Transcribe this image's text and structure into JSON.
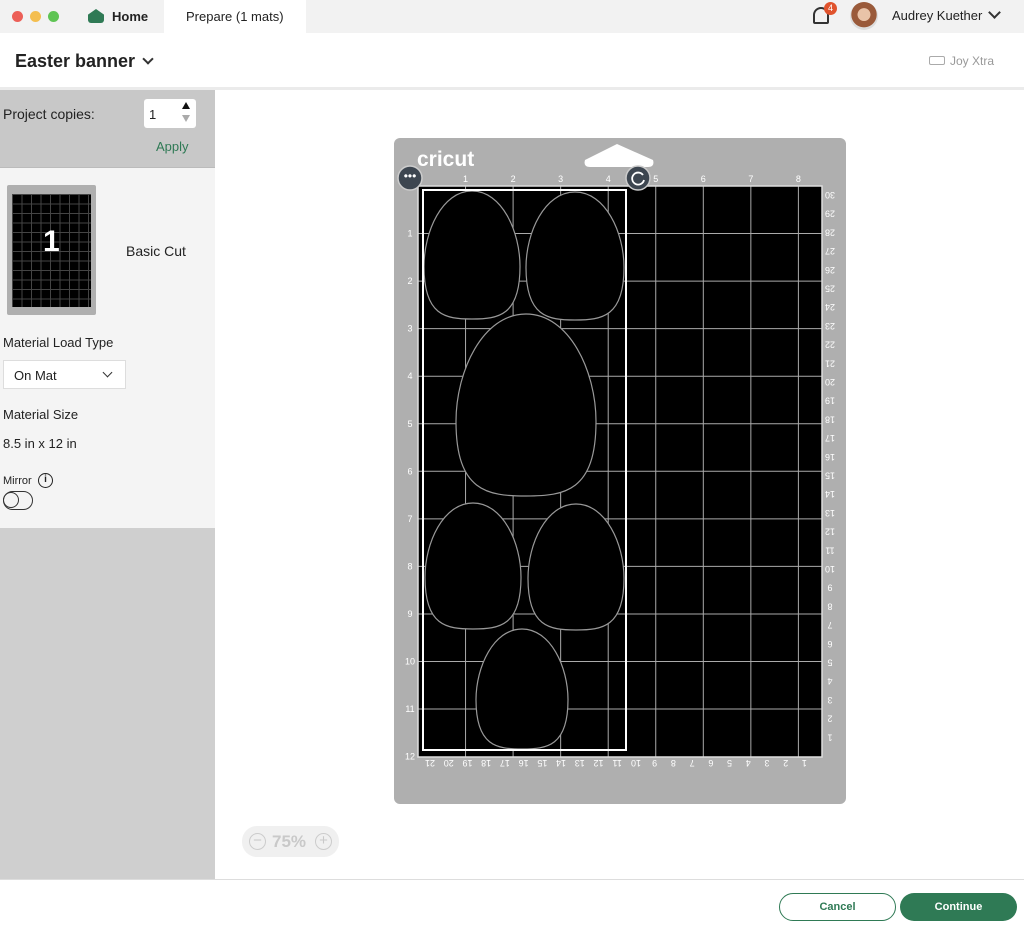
{
  "window": {
    "tabs": [
      {
        "label": "Home",
        "icon": "home-icon"
      },
      {
        "label": "Prepare (1 mats)"
      }
    ],
    "notifications": "4",
    "user": "Audrey Kuether"
  },
  "header": {
    "title": "Easter banner",
    "machine": "Joy Xtra"
  },
  "sidebar": {
    "copies_label": "Project copies:",
    "copies_value": "1",
    "apply": "Apply",
    "mat_number": "1",
    "mat_label": "Basic Cut",
    "load_type_label": "Material Load Type",
    "load_type_value": "On Mat",
    "size_label": "Material Size",
    "size_value": "8.5 in x 12 in",
    "mirror_label": "Mirror",
    "mirror_on": false
  },
  "mat": {
    "brand": "cricut",
    "top_ruler": [
      "1",
      "2",
      "3",
      "4",
      "5",
      "6",
      "7",
      "8"
    ],
    "left_ruler": [
      "1",
      "2",
      "3",
      "4",
      "5",
      "6",
      "7",
      "8",
      "9",
      "10",
      "11",
      "12"
    ],
    "right_ruler": [
      "30",
      "29",
      "28",
      "27",
      "26",
      "25",
      "24",
      "23",
      "22",
      "21",
      "20",
      "19",
      "18",
      "17",
      "16",
      "15",
      "14",
      "13",
      "12",
      "11",
      "10",
      "9",
      "8",
      "7",
      "6",
      "5",
      "4",
      "3",
      "2",
      "1"
    ],
    "bottom_ruler": [
      "21",
      "20",
      "19",
      "18",
      "17",
      "16",
      "15",
      "14",
      "13",
      "12",
      "11",
      "10",
      "9",
      "8",
      "7",
      "6",
      "5",
      "4",
      "3",
      "2",
      "1"
    ]
  },
  "zoom": {
    "value": "75%"
  },
  "footer": {
    "cancel": "Cancel",
    "continue": "Continue"
  },
  "colors": {
    "accent": "#2f7a55",
    "mat": "#afafaf"
  }
}
